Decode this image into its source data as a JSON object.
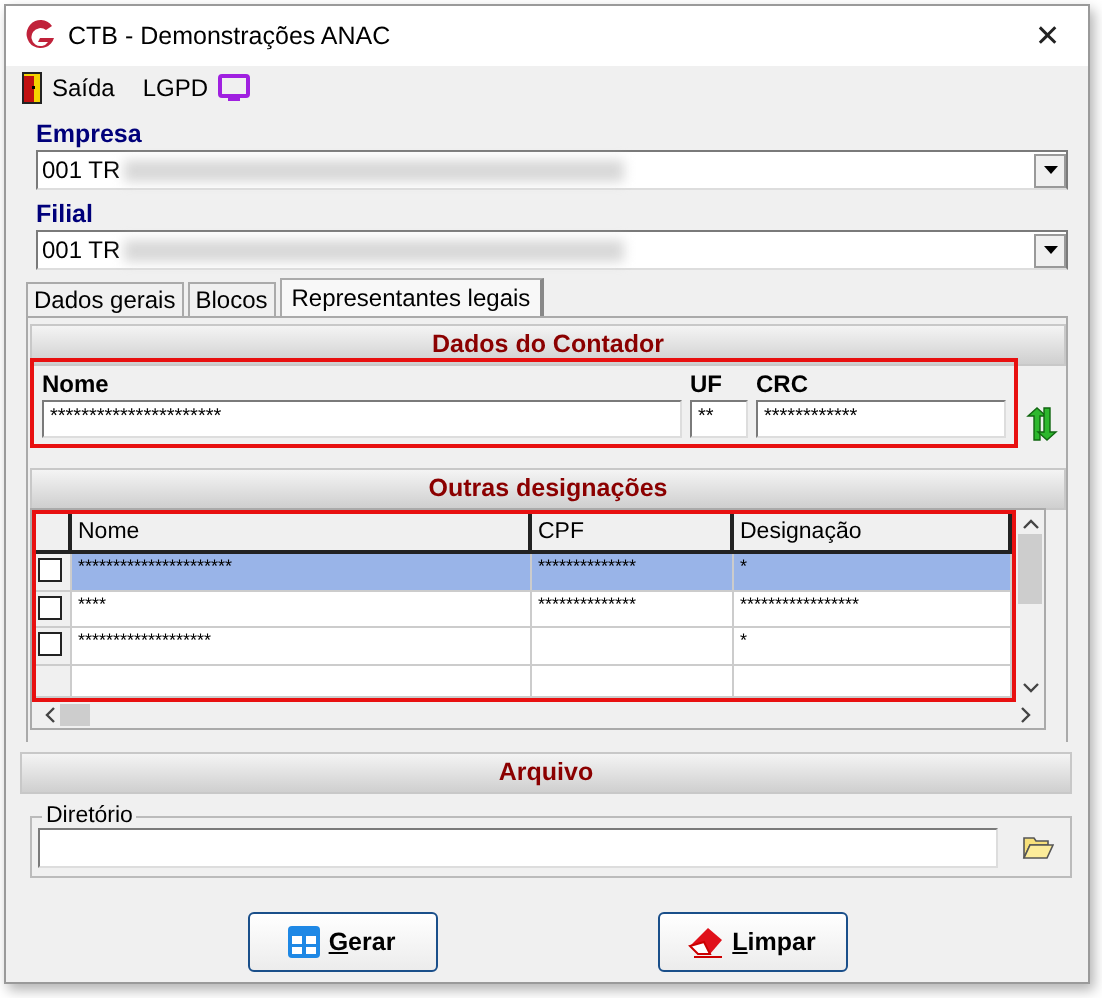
{
  "window": {
    "title": "CTB - Demonstrações ANAC",
    "close": "✕"
  },
  "toolbar": [
    {
      "label": "Saída",
      "kind": "exit"
    },
    {
      "label": "LGPD",
      "kind": "lgpd"
    }
  ],
  "empresa": {
    "label": "Empresa",
    "value": "001 TR"
  },
  "filial": {
    "label": "Filial",
    "value": "001 TR"
  },
  "tabs": [
    {
      "label": "Dados gerais",
      "selected": false
    },
    {
      "label": "Blocos",
      "selected": false
    },
    {
      "label": "Representantes legais",
      "selected": true
    }
  ],
  "contador": {
    "title": "Dados do Contador",
    "fields": [
      {
        "label": "Nome",
        "value": "**********************"
      },
      {
        "label": "UF",
        "value": "**"
      },
      {
        "label": "CRC",
        "value": "************"
      }
    ]
  },
  "outras": {
    "title": "Outras designações",
    "columns": [
      "Nome",
      "CPF",
      "Designação"
    ],
    "rows": [
      {
        "checked": false,
        "selected": true,
        "cells": [
          "**********************",
          "**************",
          "*"
        ]
      },
      {
        "checked": false,
        "selected": false,
        "cells": [
          "****",
          "**************",
          "*****************"
        ]
      },
      {
        "checked": false,
        "selected": false,
        "cells": [
          "*******************",
          "",
          "*"
        ]
      }
    ]
  },
  "arquivo": {
    "title": "Arquivo",
    "group": "Diretório"
  },
  "buttons": [
    {
      "label": "Gerar",
      "kind": "gerar"
    },
    {
      "label": "Limpar",
      "kind": "limpar"
    }
  ]
}
